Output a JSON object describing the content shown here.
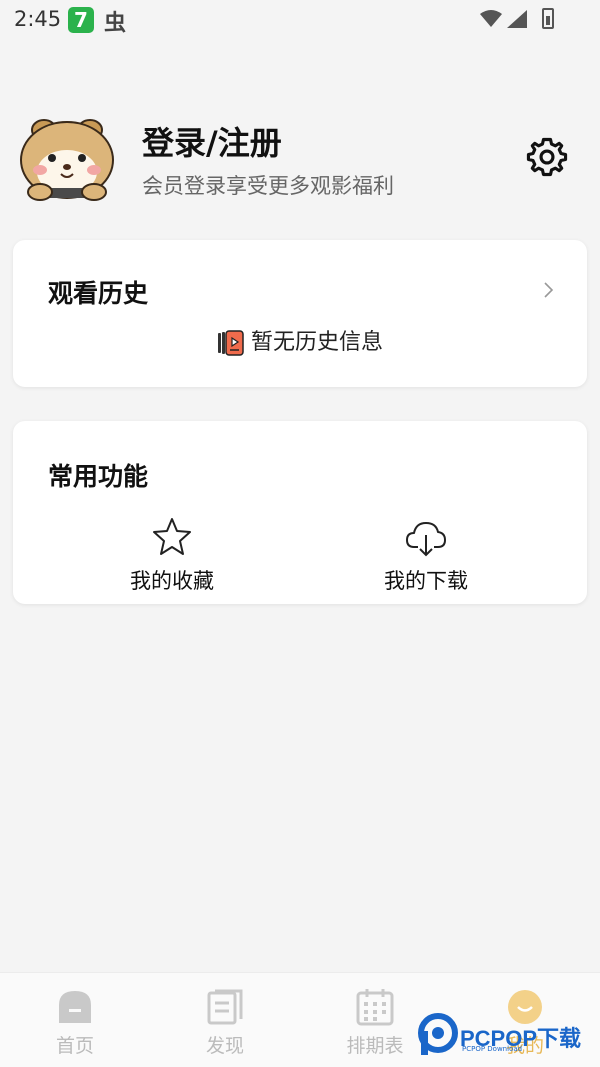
{
  "status_bar": {
    "time": "2:45",
    "app_icon_1": "7",
    "app_icon_2": "虫",
    "icons": [
      "wifi-icon",
      "signal-icon",
      "battery-icon"
    ]
  },
  "profile": {
    "title": "登录/注册",
    "subtitle": "会员登录享受更多观影福利",
    "avatar": "hamster-avatar",
    "settings_icon": "gear-icon"
  },
  "history": {
    "title": "观看历史",
    "empty_text": "暂无历史信息"
  },
  "functions": {
    "title": "常用功能",
    "items": [
      {
        "label": "我的收藏",
        "icon": "star-icon"
      },
      {
        "label": "我的下载",
        "icon": "cloud-download-icon"
      }
    ]
  },
  "tabbar": {
    "tabs": [
      {
        "label": "首页",
        "icon": "home-icon"
      },
      {
        "label": "发现",
        "icon": "discover-icon"
      },
      {
        "label": "排期表",
        "icon": "calendar-icon"
      },
      {
        "label": "我的",
        "icon": "smile-icon"
      }
    ],
    "active_index": 3
  },
  "colors": {
    "background": "#f4f4f4",
    "card": "#ffffff",
    "inactive_tab": "#bbbbbb",
    "active_tab": "#e7b857",
    "history_icon": "#f06b4c"
  },
  "watermark": {
    "text": "PCPOP下载",
    "sub": "PCPOP Download"
  }
}
